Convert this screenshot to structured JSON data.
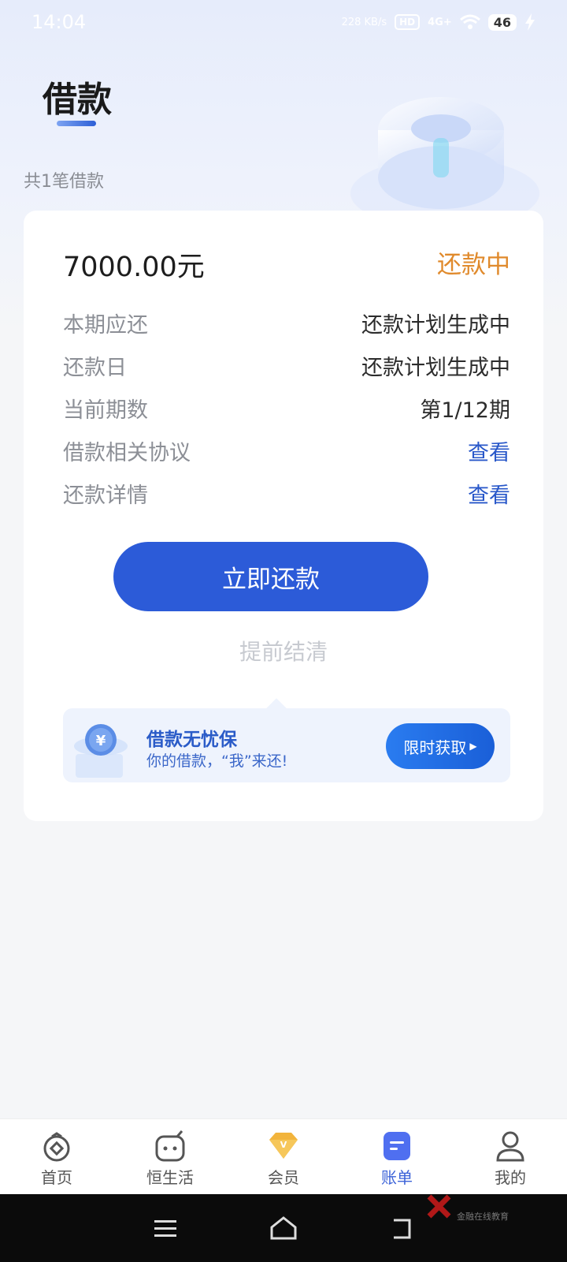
{
  "status_bar": {
    "time": "14:04",
    "net_speed": "228 KB/s",
    "hd": "HD",
    "signal": "4G+",
    "battery": "46"
  },
  "header": {
    "title": "借款",
    "loan_count": "共1笔借款"
  },
  "loan": {
    "amount": "7000.00元",
    "status": "还款中",
    "rows": [
      {
        "label": "本期应还",
        "value": "还款计划生成中"
      },
      {
        "label": "还款日",
        "value": "还款计划生成中"
      },
      {
        "label": "当前期数",
        "value": "第1/12期"
      },
      {
        "label": "借款相关协议",
        "value": "查看"
      },
      {
        "label": "还款详情",
        "value": "查看"
      }
    ],
    "repay_button": "立即还款",
    "early_settle": "提前结清"
  },
  "banner": {
    "title": "借款无忧保",
    "subtitle": "你的借款，“我”来还!",
    "button": "限时获取"
  },
  "tabs": [
    {
      "label": "首页",
      "icon": "home-icon"
    },
    {
      "label": "恒生活",
      "icon": "life-icon"
    },
    {
      "label": "会员",
      "icon": "diamond-icon"
    },
    {
      "label": "账单",
      "icon": "bill-icon"
    },
    {
      "label": "我的",
      "icon": "profile-icon"
    }
  ],
  "active_tab": "账单",
  "colors": {
    "primary": "#2c5bd8",
    "status_orange": "#e08a2c",
    "link_blue": "#2857c9"
  },
  "watermark": {
    "text": "金融在线教育"
  }
}
